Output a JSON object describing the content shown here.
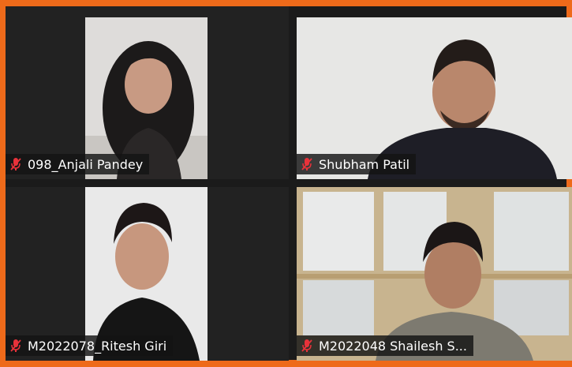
{
  "meeting": {
    "frame_color": "#ee6a1a",
    "background_color": "#1b1b1b",
    "participants": [
      {
        "name": "098_Anjali Pandey",
        "mic_icon": "mic-muted-icon",
        "mic_color": "#e8323a"
      },
      {
        "name": "Shubham Patil",
        "mic_icon": "mic-muted-icon",
        "mic_color": "#e8323a"
      },
      {
        "name": "M2022078_Ritesh Giri",
        "mic_icon": "mic-muted-icon",
        "mic_color": "#e8323a"
      },
      {
        "name": "M2022048 Shailesh S...",
        "mic_icon": "mic-muted-icon",
        "mic_color": "#e8323a"
      }
    ]
  }
}
